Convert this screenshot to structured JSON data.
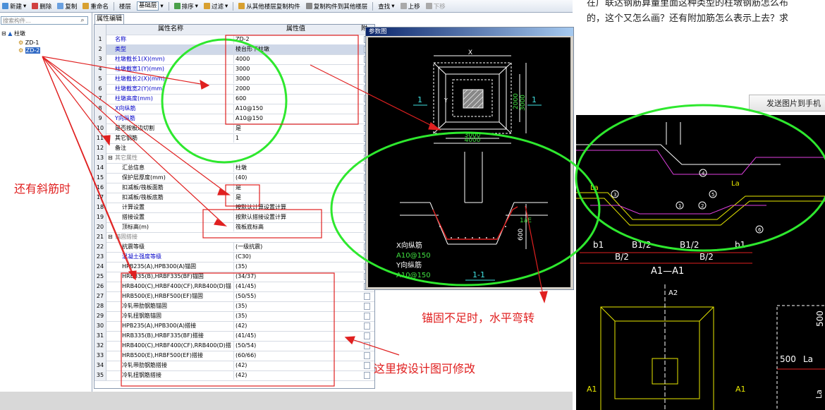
{
  "toolbar": {
    "items": [
      {
        "label": "新建",
        "icon": "new-icon",
        "dropdown": true
      },
      {
        "label": "删除",
        "icon": "delete-icon"
      },
      {
        "label": "复制",
        "icon": "copy-icon"
      },
      {
        "label": "重命名",
        "icon": "rename-icon"
      },
      {
        "label": "楼层",
        "icon": ""
      },
      {
        "label": "基础层",
        "icon": "",
        "combo": true
      },
      {
        "label": "排序",
        "icon": "sort-icon",
        "dropdown": true
      },
      {
        "label": "过滤",
        "icon": "filter-icon",
        "dropdown": true
      },
      {
        "label": "从其他楼层复制构件",
        "icon": "copy-from-floor-icon"
      },
      {
        "label": "复制构件到其他楼层",
        "icon": "copy-to-floor-icon"
      },
      {
        "label": "查找",
        "icon": "",
        "dropdown": true
      },
      {
        "label": "上移",
        "icon": "up-arrow-icon"
      },
      {
        "label": "下移",
        "icon": "down-arrow-icon",
        "disabled": true
      }
    ]
  },
  "left": {
    "search_placeholder": "搜索构件...",
    "tree_root": "柱墩",
    "tree_items": [
      "ZD-1",
      "ZD-2"
    ],
    "selected": "ZD-2"
  },
  "grid": {
    "tab": "属性编辑",
    "col_name": "属性名称",
    "col_value": "属性值",
    "col_extra": "附",
    "rows": [
      {
        "n": "1",
        "name": "名称",
        "value": "ZD-2",
        "style": "blue"
      },
      {
        "n": "2",
        "name": "类型",
        "value": "棱台形下柱墩",
        "style": "blue",
        "hl": true
      },
      {
        "n": "3",
        "name": "柱墩截长1(X)(mm)",
        "value": "4000",
        "style": "blue"
      },
      {
        "n": "4",
        "name": "柱墩截宽1(Y)(mm)",
        "value": "3000",
        "style": "blue"
      },
      {
        "n": "5",
        "name": "柱墩截长2(X)(mm)",
        "value": "3000",
        "style": "blue"
      },
      {
        "n": "6",
        "name": "柱墩截宽2(Y)(mm)",
        "value": "2000",
        "style": "blue"
      },
      {
        "n": "7",
        "name": "柱墩高度(mm)",
        "value": "600",
        "style": "blue"
      },
      {
        "n": "8",
        "name": "X向纵筋",
        "value": "A10@150",
        "style": "blue"
      },
      {
        "n": "9",
        "name": "Y向纵筋",
        "value": "A10@150",
        "style": "blue"
      },
      {
        "n": "10",
        "name": "是否按板边切割",
        "value": "是",
        "style": ""
      },
      {
        "n": "11",
        "name": "其它钢筋",
        "value": "1",
        "style": ""
      },
      {
        "n": "12",
        "name": "备注",
        "value": "",
        "style": ""
      },
      {
        "n": "13",
        "name": "其它属性",
        "value": "",
        "style": "grey",
        "group": true
      },
      {
        "n": "14",
        "name": "汇总信息",
        "value": "柱墩",
        "style": "",
        "indent": true
      },
      {
        "n": "15",
        "name": "保护层厚度(mm)",
        "value": "(40)",
        "style": "",
        "indent": true
      },
      {
        "n": "16",
        "name": "扣减板/筏板面筋",
        "value": "是",
        "style": "",
        "indent": true
      },
      {
        "n": "17",
        "name": "扣减板/筏板底筋",
        "value": "是",
        "style": "",
        "indent": true
      },
      {
        "n": "18",
        "name": "计算设置",
        "value": "按默认计算设置计算",
        "style": "",
        "indent": true
      },
      {
        "n": "19",
        "name": "搭接设置",
        "value": "按默认搭接设置计算",
        "style": "",
        "indent": true
      },
      {
        "n": "20",
        "name": "顶标高(m)",
        "value": "筏板底标高",
        "style": "",
        "indent": true
      },
      {
        "n": "21",
        "name": "锚固搭接",
        "value": "",
        "style": "grey",
        "group": true
      },
      {
        "n": "22",
        "name": "抗震等级",
        "value": "(一级抗震)",
        "style": "",
        "indent": true
      },
      {
        "n": "23",
        "name": "混凝土强度等级",
        "value": "(C30)",
        "style": "blue",
        "indent": true
      },
      {
        "n": "24",
        "name": "HPB235(A),HPB300(A)锚固",
        "value": "(35)",
        "style": "",
        "indent": true
      },
      {
        "n": "25",
        "name": "HRB335(B),HRBF335(BF)锚固",
        "value": "(34/37)",
        "style": "",
        "indent": true
      },
      {
        "n": "26",
        "name": "HRB400(C),HRBF400(CF),RRB400(D)锚",
        "value": "(41/45)",
        "style": "",
        "indent": true
      },
      {
        "n": "27",
        "name": "HRB500(E),HRBF500(EF)锚固",
        "value": "(50/55)",
        "style": "",
        "indent": true
      },
      {
        "n": "28",
        "name": "冷轧带肋钢筋锚固",
        "value": "(35)",
        "style": "",
        "indent": true
      },
      {
        "n": "29",
        "name": "冷轧扭钢筋锚固",
        "value": "(35)",
        "style": "",
        "indent": true
      },
      {
        "n": "30",
        "name": "HPB235(A),HPB300(A)搭接",
        "value": "(42)",
        "style": "",
        "indent": true
      },
      {
        "n": "31",
        "name": "HRB335(B),HRBF335(BF)搭接",
        "value": "(41/45)",
        "style": "",
        "indent": true
      },
      {
        "n": "32",
        "name": "HRB400(C),HRBF400(CF),RRB400(D)搭",
        "value": "(50/54)",
        "style": "",
        "indent": true
      },
      {
        "n": "33",
        "name": "HRB500(E),HRBF500(EF)搭接",
        "value": "(60/66)",
        "style": "",
        "indent": true
      },
      {
        "n": "34",
        "name": "冷轧带肋钢筋搭接",
        "value": "(42)",
        "style": "",
        "indent": true
      },
      {
        "n": "35",
        "name": "冷轧扭钢筋搭接",
        "value": "(42)",
        "style": "",
        "indent": true
      }
    ]
  },
  "dialog": {
    "title": "参数图",
    "plan": {
      "x_label": "X",
      "y_label": "Y",
      "dim_inner_w": "3000",
      "dim_outer_w": "4000",
      "dim_inner_h": "2000",
      "dim_outer_h": "3000",
      "section_mark": "1"
    },
    "section": {
      "lae": "1aE",
      "height": "600",
      "x_rebar_label": "X向纵筋",
      "x_rebar_value": "A10@150",
      "y_rebar_label": "Y向纵筋",
      "y_rebar_value": "A10@150",
      "title": "1-1"
    }
  },
  "right": {
    "line1": "在广联达钢筋算量里面这种类型的柱墩钢筋怎么布",
    "line2": "的，这个又怎么画？还有附加筋怎么表示上去？求",
    "send_button": "发送图片到手机",
    "cad": {
      "b1_half_left": "B1/2",
      "b1_half_right": "B1/2",
      "b1_left": "b1",
      "b1_right": "b1",
      "b_half_left": "B/2",
      "b_half_right": "B/2",
      "section_title": "A1—A1",
      "la1": "La",
      "la2": "La",
      "a2": "A2",
      "a1_left": "A1",
      "a1_right": "A1",
      "dim_500_v": "500",
      "dim_500_h": "500",
      "la_bottom": "La",
      "la_side": "La",
      "circle_labels": [
        "1",
        "2",
        "3",
        "4",
        "5",
        "6"
      ]
    }
  },
  "annotations": {
    "oblique_rebar": "还有斜筋时",
    "anchor_bend": "锚固不足时，水平弯转",
    "editable": "这里按设计图可修改"
  },
  "colors": {
    "ellipse": "#2ee82e",
    "arrow": "#e02020",
    "annotation_text": "#e02020",
    "cad_yellow": "#e8e800",
    "cad_magenta": "#e040e0",
    "cad_cyan": "#40e0e0",
    "cad_green": "#40e040"
  }
}
